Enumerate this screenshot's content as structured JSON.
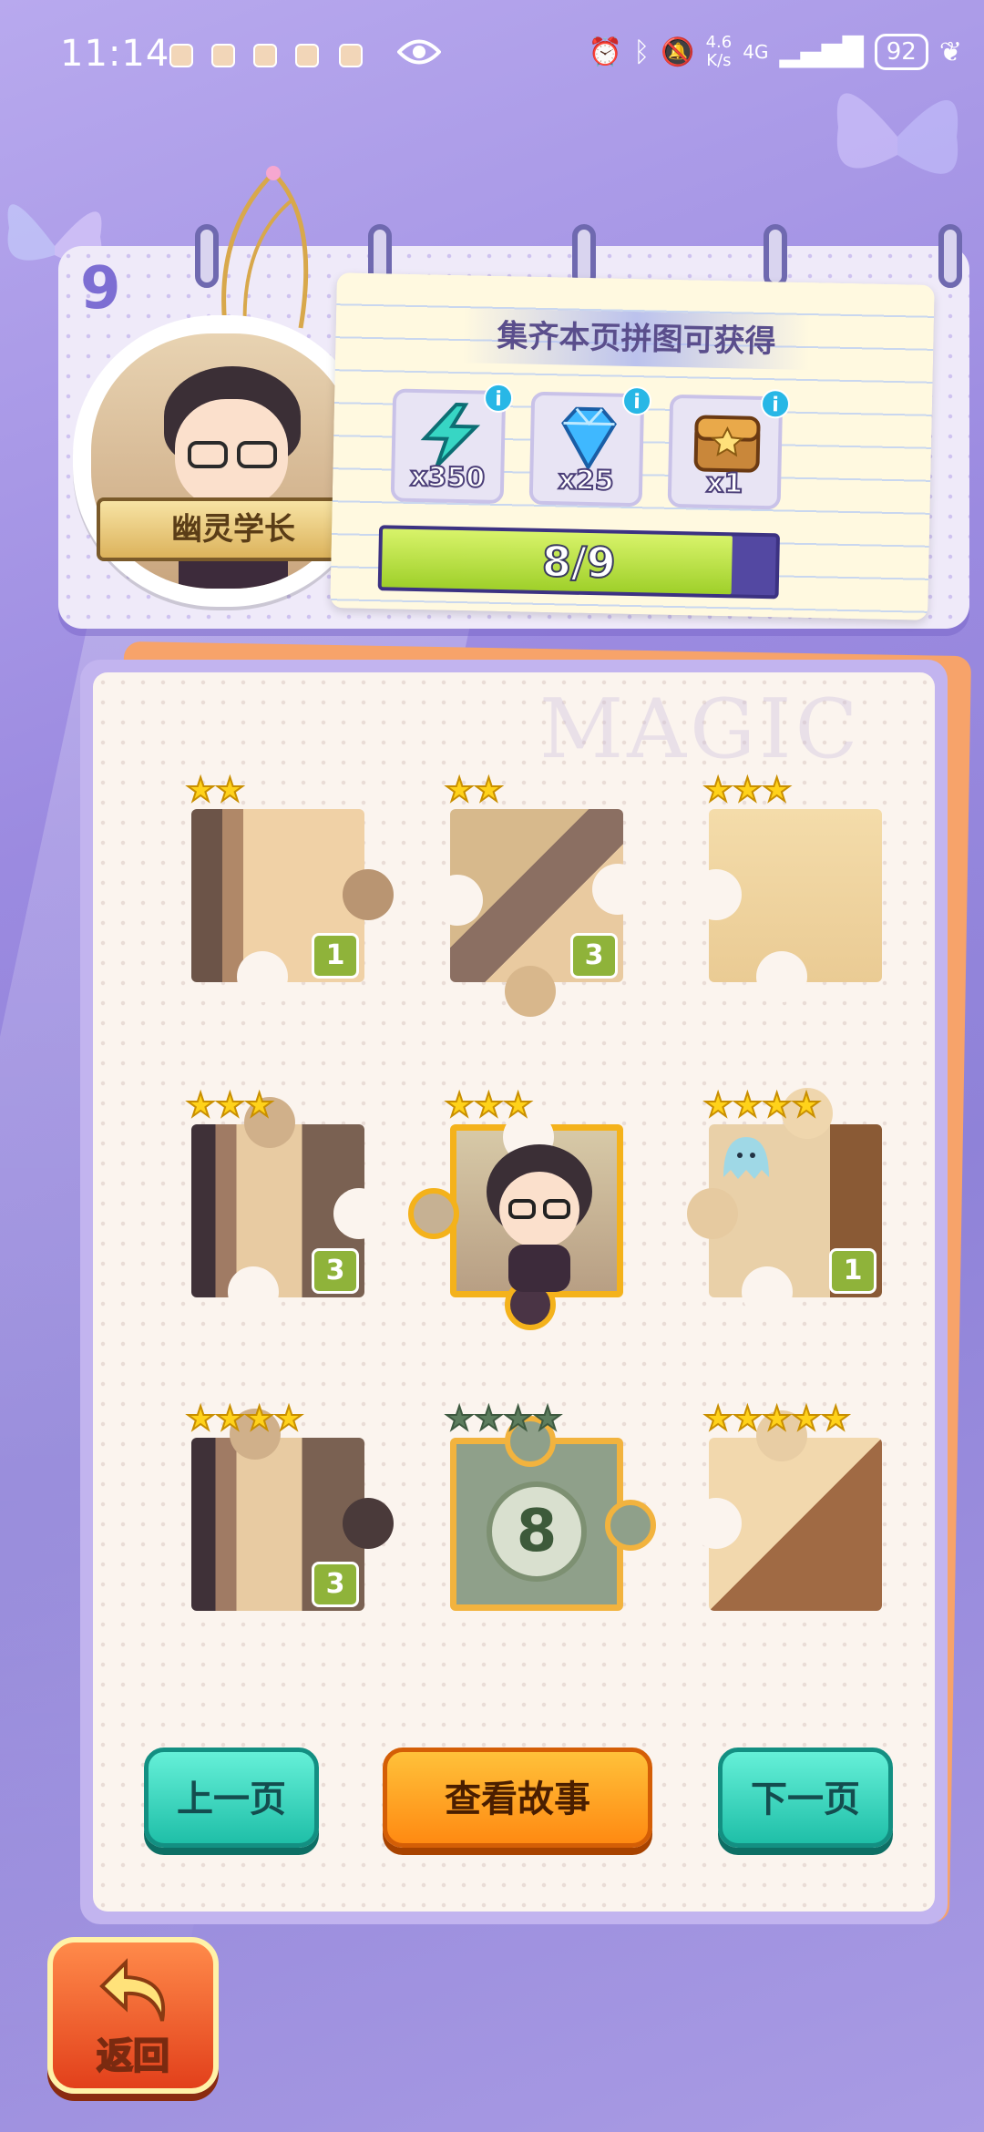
{
  "status_bar": {
    "time": "11:14",
    "net_speed_value": "4.6",
    "net_speed_unit": "K/s",
    "network": "4G",
    "battery": "92"
  },
  "chapter": {
    "page_number": "9",
    "character_name": "幽灵学长"
  },
  "rewards": {
    "title": "集齐本页拼图可获得",
    "items": [
      {
        "icon": "lightning-icon",
        "quantity": "x350",
        "info": "i"
      },
      {
        "icon": "diamond-icon",
        "quantity": "x25",
        "info": "i"
      },
      {
        "icon": "treasure-chest-icon",
        "quantity": "x1",
        "info": "i"
      }
    ],
    "progress_text": "8/9",
    "progress_value": 0.889
  },
  "board": {
    "watermark": "MAGIC",
    "pieces": [
      {
        "stars": "★★",
        "count": "1"
      },
      {
        "stars": "★★",
        "count": "3"
      },
      {
        "stars": "★★★",
        "count": ""
      },
      {
        "stars": "★★★",
        "count": "3"
      },
      {
        "stars": "★★★",
        "count": ""
      },
      {
        "stars": "★★★★",
        "count": "1"
      },
      {
        "stars": "★★★★",
        "count": "3"
      },
      {
        "stars": "★★★★",
        "count": "8"
      },
      {
        "stars": "★★★★★",
        "count": ""
      }
    ]
  },
  "buttons": {
    "prev_page": "上一页",
    "view_story": "查看故事",
    "next_page": "下一页",
    "back": "返回"
  },
  "colors": {
    "accent_green": "#1fbfa8",
    "accent_orange": "#ff8a12",
    "star_gold": "#ffd21a"
  }
}
